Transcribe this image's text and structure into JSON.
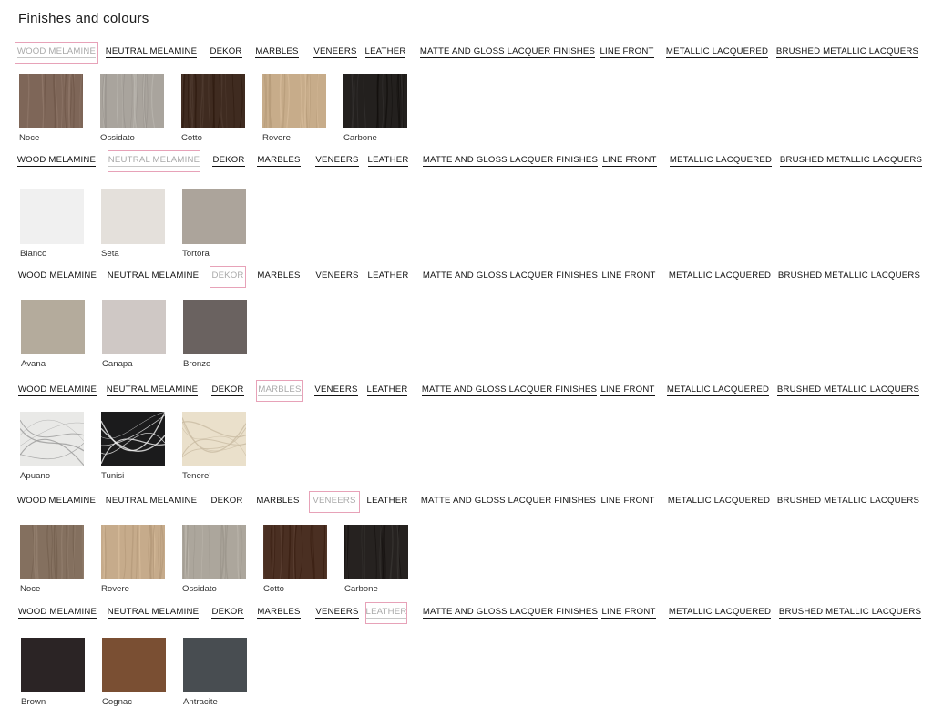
{
  "page_title": "Finishes and colours",
  "tab_labels": [
    "WOOD MELAMINE",
    "NEUTRAL MELAMINE",
    "DEKOR",
    "MARBLES",
    "VENEERS",
    "LEATHER",
    "MATTE AND GLOSS LACQUER FINISHES",
    "LINE FRONT",
    "METALLIC LACQUERED",
    "BRUSHED METALLIC LACQUERS"
  ],
  "sections": [
    {
      "active_tab": 0,
      "swatches": [
        {
          "name": "Noce",
          "color": "#7e6658",
          "texture": "wood"
        },
        {
          "name": "Ossidato",
          "color": "#a9a49d",
          "texture": "wood"
        },
        {
          "name": "Cotto",
          "color": "#3f2b20",
          "texture": "wood"
        },
        {
          "name": "Rovere",
          "color": "#c7ac8a",
          "texture": "wood"
        },
        {
          "name": "Carbone",
          "color": "#23201e",
          "texture": "wood"
        }
      ]
    },
    {
      "active_tab": 1,
      "swatches": [
        {
          "name": "Bianco",
          "color": "#f0f0f0",
          "texture": "plain"
        },
        {
          "name": "Seta",
          "color": "#e4e0db",
          "texture": "plain"
        },
        {
          "name": "Tortora",
          "color": "#aca49b",
          "texture": "plain"
        }
      ]
    },
    {
      "active_tab": 2,
      "swatches": [
        {
          "name": "Avana",
          "color": "#b4ab9c",
          "texture": "plain"
        },
        {
          "name": "Canapa",
          "color": "#cfc8c5",
          "texture": "plain"
        },
        {
          "name": "Bronzo",
          "color": "#6a6260",
          "texture": "plain"
        }
      ]
    },
    {
      "active_tab": 3,
      "swatches": [
        {
          "name": "Apuano",
          "color": "#e9e9e7",
          "texture": "marble-light"
        },
        {
          "name": "Tunisi",
          "color": "#1b1b1c",
          "texture": "marble-dark"
        },
        {
          "name": "Tenere'",
          "color": "#eae0cb",
          "texture": "marble-cream"
        }
      ]
    },
    {
      "active_tab": 4,
      "swatches": [
        {
          "name": "Noce",
          "color": "#84705f",
          "texture": "wood"
        },
        {
          "name": "Rovere",
          "color": "#c6ab8b",
          "texture": "wood"
        },
        {
          "name": "Ossidato",
          "color": "#aca69c",
          "texture": "wood"
        },
        {
          "name": "Cotto",
          "color": "#4a2f22",
          "texture": "wood"
        },
        {
          "name": "Carbone",
          "color": "#262220",
          "texture": "wood"
        }
      ]
    },
    {
      "active_tab": 5,
      "swatches": [
        {
          "name": "Brown",
          "color": "#2b2425",
          "texture": "plain"
        },
        {
          "name": "Cognac",
          "color": "#7a4f33",
          "texture": "plain"
        },
        {
          "name": "Antracite",
          "color": "#484d51",
          "texture": "plain"
        }
      ]
    }
  ]
}
